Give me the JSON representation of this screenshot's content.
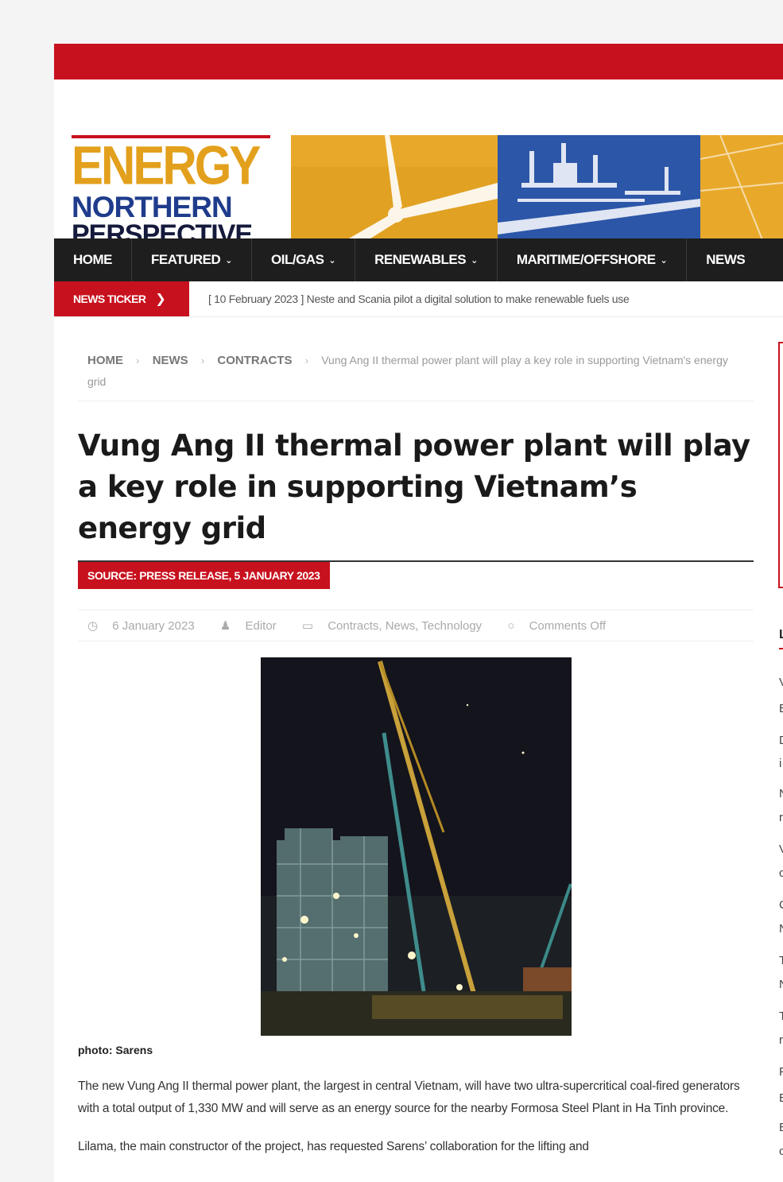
{
  "logo": {
    "line1": "ENERGY",
    "line2": "NORTHERN",
    "line3": "PERSPECTIVE"
  },
  "nav": {
    "items": [
      {
        "label": "HOME",
        "dropdown": false
      },
      {
        "label": "FEATURED",
        "dropdown": true
      },
      {
        "label": "OIL/GAS",
        "dropdown": true
      },
      {
        "label": "RENEWABLES",
        "dropdown": true
      },
      {
        "label": "MARITIME/OFFSHORE",
        "dropdown": true
      },
      {
        "label": "NEWS",
        "dropdown": false
      }
    ]
  },
  "ticker": {
    "label": "NEWS TICKER",
    "text": "[ 10 February 2023 ]  Neste and Scania pilot a digital solution to make renewable fuels use"
  },
  "breadcrumb": {
    "home": "HOME",
    "news": "NEWS",
    "contracts": "CONTRACTS",
    "current": "Vung Ang II thermal power plant will play a key role in supporting Vietnam's energy grid"
  },
  "article": {
    "title": "Vung Ang II thermal power plant will play a key role in supporting Vietnam’s energy grid",
    "source": "SOURCE: PRESS RELEASE, 5 JANUARY 2023",
    "meta": {
      "date": "6 January 2023",
      "author": "Editor",
      "categories": "Contracts, News, Technology",
      "comments": "Comments Off"
    },
    "caption": "photo: Sarens",
    "paragraphs": [
      "The new Vung Ang II thermal power plant, the largest in central Vietnam, will have two ultra-supercritical coal-fired generators with a total output of 1,330 MW and will serve as an energy source for the nearby Formosa Steel Plant in Ha Tinh province.",
      "Lilama, the main constructor of the project, has requested Sarens’ collaboration for the lifting and"
    ]
  },
  "sidebar": {
    "heading": "L",
    "letters": [
      "V",
      "E",
      "D",
      "i",
      "N",
      "r",
      "V",
      "c",
      "C",
      "N",
      "T",
      "N",
      "T",
      "r",
      "F",
      "E",
      "E",
      "c"
    ]
  },
  "colors": {
    "accent": "#c8111e",
    "nav_bg": "#1e1e1e",
    "logo_gold": "#e3a01c",
    "logo_blue": "#1f3c8c"
  }
}
